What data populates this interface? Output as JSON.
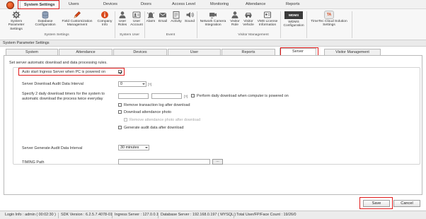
{
  "menubar": {
    "tabs": [
      "System Settings",
      "Users",
      "Devices",
      "Doors",
      "Access Level",
      "Monitoring",
      "Attendance",
      "Reports"
    ]
  },
  "ribbon": {
    "buttons": [
      {
        "label": "System Parameter Settings",
        "icon": "gear-settings-icon"
      },
      {
        "label": "Database Configuration",
        "icon": "database-icon"
      },
      {
        "label": "Field Customization Management",
        "icon": "pencil-icon"
      },
      {
        "label": "Company Info",
        "icon": "info-icon"
      },
      {
        "label": "User Roles",
        "icon": "user-role-icon"
      },
      {
        "label": "User Account",
        "icon": "user-account-icon"
      },
      {
        "label": "Alarm",
        "icon": "alarm-icon"
      },
      {
        "label": "Email",
        "icon": "email-icon"
      },
      {
        "label": "Activity",
        "icon": "activity-icon"
      },
      {
        "label": "Sound",
        "icon": "sound-icon"
      },
      {
        "label": "Network Camera Integration",
        "icon": "camera-icon"
      },
      {
        "label": "Visitor Role",
        "icon": "visitor-role-icon"
      },
      {
        "label": "Visitor Vehicle",
        "icon": "vehicle-icon"
      },
      {
        "label": "VMS License Information",
        "icon": "license-icon"
      },
      {
        "label": "WDMS Configuration",
        "icon": "wdms-icon"
      },
      {
        "label": "TimeTec Cloud Solution Settings",
        "icon": "cloud-icon"
      }
    ],
    "groups": [
      "System Settings",
      "System User",
      "Event",
      "Visitor Management"
    ],
    "wdms_logo": "WDMS",
    "ta_logo": "TA"
  },
  "section_title": "System Parameter Settings",
  "tabs": [
    "System",
    "Attendance",
    "Devices",
    "User",
    "Reports",
    "Server",
    "Visitor Management"
  ],
  "server": {
    "description": "Set server automatic download and data processing rules.",
    "auto_start_label": "Auto start Ingress Server when PC is powered on",
    "download_interval_label": "Server Download Audit Data Interval",
    "download_interval_value": "0",
    "specify_timers_label_1": "Specify 2 daily download timers for the system to",
    "specify_timers_label_2": "automatic download the process twice everyday",
    "perform_daily_label": "Perform daily download when computer is powered on",
    "help_mark": "[?]",
    "remove_log_label": "Remove transaction log after download",
    "download_photo_label": "Download attendance photo",
    "remove_photo_label": "Remove attendance photo after download",
    "generate_audit_label": "Generate audit data after download",
    "generate_interval_label": "Server Generate Audit Data Interval",
    "generate_interval_value": "30 minutes",
    "timing_path_label": "TIMING Path",
    "browse_label": "..."
  },
  "buttons": {
    "save": "Save",
    "cancel": "Cancel"
  },
  "status": {
    "login": "Login Info : admin ( 00:02:30 )",
    "sdk": "SDK Version : 6.2.5.7.4078-01",
    "ingress": "Ingress Server : 127.0.0.1",
    "database": "Database Server : 192.168.0.197 ( MYSQL )",
    "totals": "Total User/FP/Face Count : 19/26/0"
  },
  "colors": {
    "highlight": "#e01a1a",
    "orb": "#d9481a"
  }
}
